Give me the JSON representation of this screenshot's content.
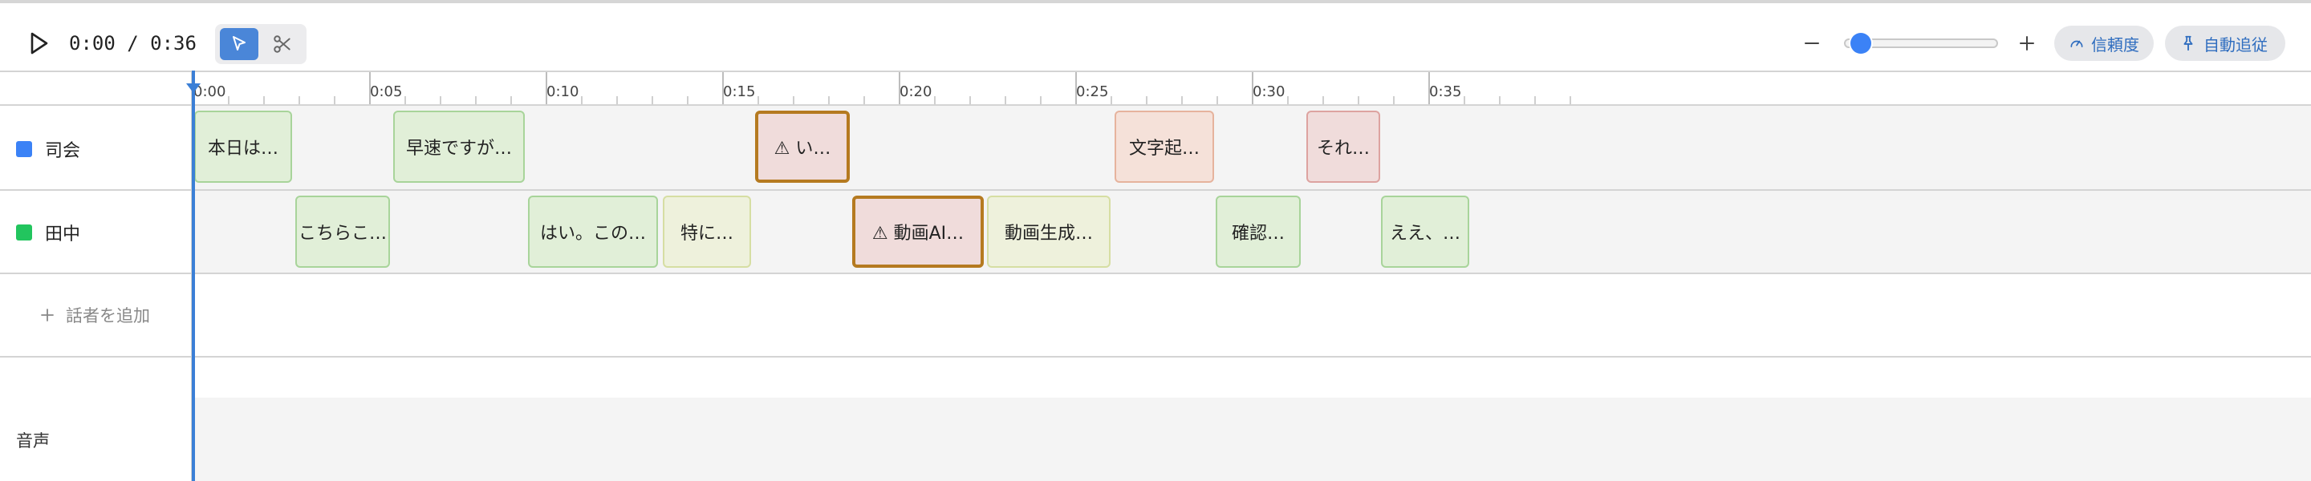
{
  "player": {
    "timecode": "0:00 / 0:36",
    "play_icon": "play-icon"
  },
  "tools": {
    "select_icon": "cursor-arrow-icon",
    "cut_icon": "scissors-icon",
    "active": "select"
  },
  "zoom": {
    "minus": "−",
    "plus": "+",
    "level": 0.05
  },
  "buttons": {
    "confidence_label": "信頼度",
    "autofollow_label": "自動追従"
  },
  "ruler": {
    "labels": [
      "0:00",
      "0:05",
      "0:10",
      "0:15",
      "0:20",
      "0:25",
      "0:30",
      "0:35"
    ]
  },
  "tracks": [
    {
      "name": "司会",
      "color": "#3b82f6",
      "clips": [
        {
          "text": "本日は…",
          "style": "green",
          "warn": false
        },
        {
          "text": "早速ですが…",
          "style": "green",
          "warn": false
        },
        {
          "text": "⚠ い…",
          "style": "warn",
          "warn": true
        },
        {
          "text": "文字起…",
          "style": "orange",
          "warn": false
        },
        {
          "text": "それ…",
          "style": "red",
          "warn": false
        }
      ]
    },
    {
      "name": "田中",
      "color": "#22c55e",
      "clips": [
        {
          "text": "こちらこ…",
          "style": "green",
          "warn": false
        },
        {
          "text": "はい。この…",
          "style": "green",
          "warn": false
        },
        {
          "text": "特に…",
          "style": "yellow",
          "warn": false
        },
        {
          "text": "⚠ 動画AI…",
          "style": "warn",
          "warn": true
        },
        {
          "text": "動画生成…",
          "style": "yellow",
          "warn": false
        },
        {
          "text": "確認…",
          "style": "green",
          "warn": false
        },
        {
          "text": "ええ、…",
          "style": "green",
          "warn": false
        }
      ]
    }
  ],
  "add_speaker": {
    "icon": "plus-icon",
    "label": "話者を追加"
  },
  "audio_track": {
    "label": "音声"
  }
}
